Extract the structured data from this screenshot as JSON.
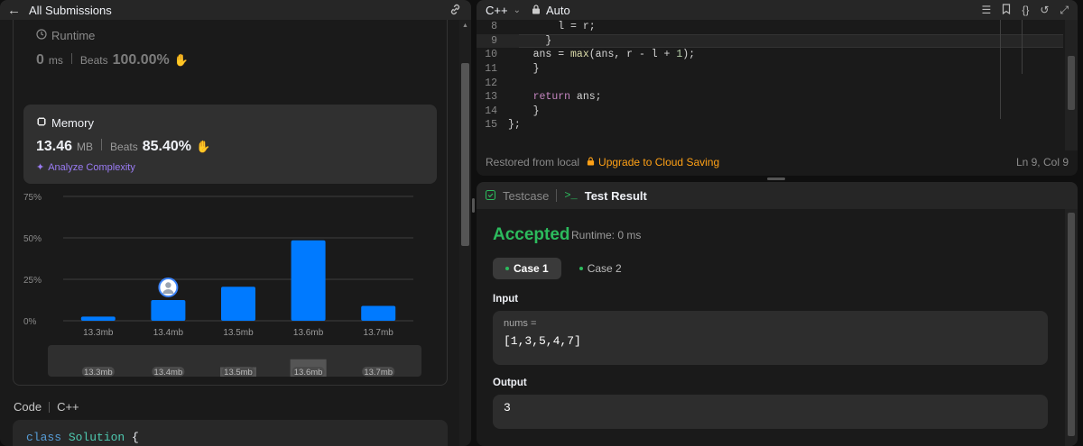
{
  "left": {
    "header_title": "All Submissions",
    "runtime": {
      "label": "Runtime",
      "value": "0",
      "unit": "ms",
      "beats_label": "Beats",
      "beats_value": "100.00%"
    },
    "memory": {
      "label": "Memory",
      "value": "13.46",
      "unit": "MB",
      "beats_label": "Beats",
      "beats_value": "85.40%"
    },
    "analyze_label": "Analyze Complexity",
    "code_label": "Code",
    "lang_label": "C++",
    "code_preview": {
      "kw": "class",
      "name": "Solution",
      "brace": " {"
    }
  },
  "chart_data": {
    "type": "bar",
    "categories": [
      "13.3mb",
      "13.4mb",
      "13.5mb",
      "13.6mb",
      "13.7mb"
    ],
    "values": [
      2.5,
      12.5,
      20.5,
      48.5,
      9.0
    ],
    "yticks": [
      "75%",
      "50%",
      "25%",
      "0%"
    ],
    "ylim": [
      0,
      75
    ],
    "highlight_index": 1,
    "color": "#007aff",
    "mini_bars": [
      0,
      0,
      0.3,
      0.55,
      0
    ]
  },
  "editor": {
    "language": "C++",
    "mode": "Auto",
    "lines": [
      {
        "n": "8",
        "t": "        l = r;"
      },
      {
        "n": "9",
        "t": "      }"
      },
      {
        "n": "10",
        "t": "    ans = max(ans, r - l + 1);"
      },
      {
        "n": "11",
        "t": "    }"
      },
      {
        "n": "12",
        "t": ""
      },
      {
        "n": "13",
        "t": "    return ans;"
      },
      {
        "n": "14",
        "t": "    }"
      },
      {
        "n": "15",
        "t": "};"
      }
    ],
    "footer_status": "Restored from local",
    "footer_upgrade": "Upgrade to Cloud Saving",
    "footer_pos": "Ln 9, Col 9"
  },
  "result": {
    "tab_testcase": "Testcase",
    "tab_result": "Test Result",
    "status": "Accepted",
    "runtime": "Runtime: 0 ms",
    "cases": [
      "Case 1",
      "Case 2"
    ],
    "input_label": "Input",
    "input_var": "nums =",
    "input_value": "[1,3,5,4,7]",
    "output_label": "Output",
    "output_value": "3"
  }
}
